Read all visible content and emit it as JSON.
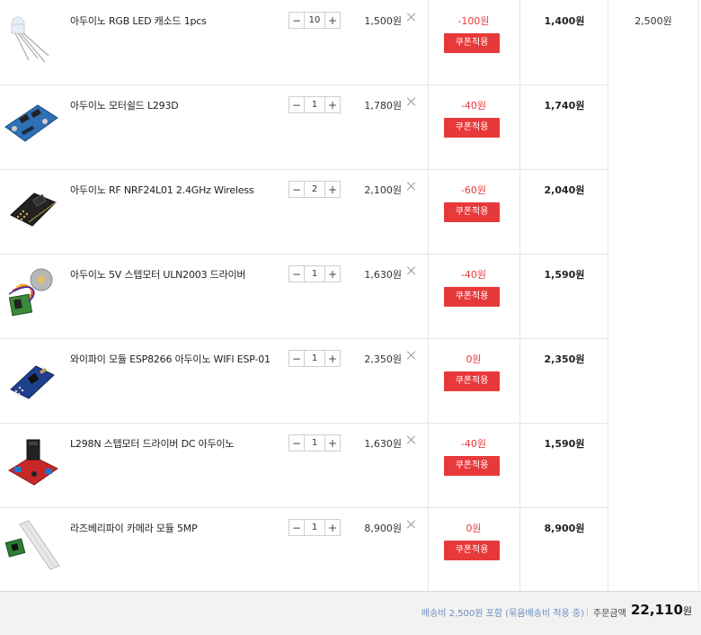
{
  "shipping_fee": "2,500원",
  "coupon_label": "쿠폰적용",
  "items": [
    {
      "name": "아두이노 RGB LED 캐소드 1pcs",
      "qty": "10",
      "price": "1,500원",
      "discount": "-100원",
      "final": "1,400원",
      "image": "led-image"
    },
    {
      "name": "아두이노 모터쉴드 L293D",
      "qty": "1",
      "price": "1,780원",
      "discount": "-40원",
      "final": "1,740원",
      "image": "motor-shield-image"
    },
    {
      "name": "아두이노 RF NRF24L01 2.4GHz Wireless",
      "qty": "2",
      "price": "2,100원",
      "discount": "-60원",
      "final": "2,040원",
      "image": "rf-module-image"
    },
    {
      "name": "아두이노 5V 스텝모터 ULN2003 드라이버",
      "qty": "1",
      "price": "1,630원",
      "discount": "-40원",
      "final": "1,590원",
      "image": "stepper-motor-image"
    },
    {
      "name": "와이파이 모듈 ESP8266 아두이노 WIFI ESP-01",
      "qty": "1",
      "price": "2,350원",
      "discount": "0원",
      "final": "2,350원",
      "image": "wifi-module-image"
    },
    {
      "name": "L298N 스텝모터 드라이버 DC 아두이노",
      "qty": "1",
      "price": "1,630원",
      "discount": "-40원",
      "final": "1,590원",
      "image": "l298n-image"
    },
    {
      "name": "라즈베리파이 카메라 모듈 5MP",
      "qty": "1",
      "price": "8,900원",
      "discount": "0원",
      "final": "8,900원",
      "image": "camera-module-image"
    }
  ],
  "footer": {
    "shipping_note": "배송비 2,500원 포함 (묶음배송비 적용 중)",
    "total_label": "주문금액",
    "total_value": "22,110",
    "total_unit": "원"
  },
  "colors": {
    "accent": "#e8393a",
    "footer_bg": "#f2f2f2",
    "note": "#6a8fbf"
  }
}
